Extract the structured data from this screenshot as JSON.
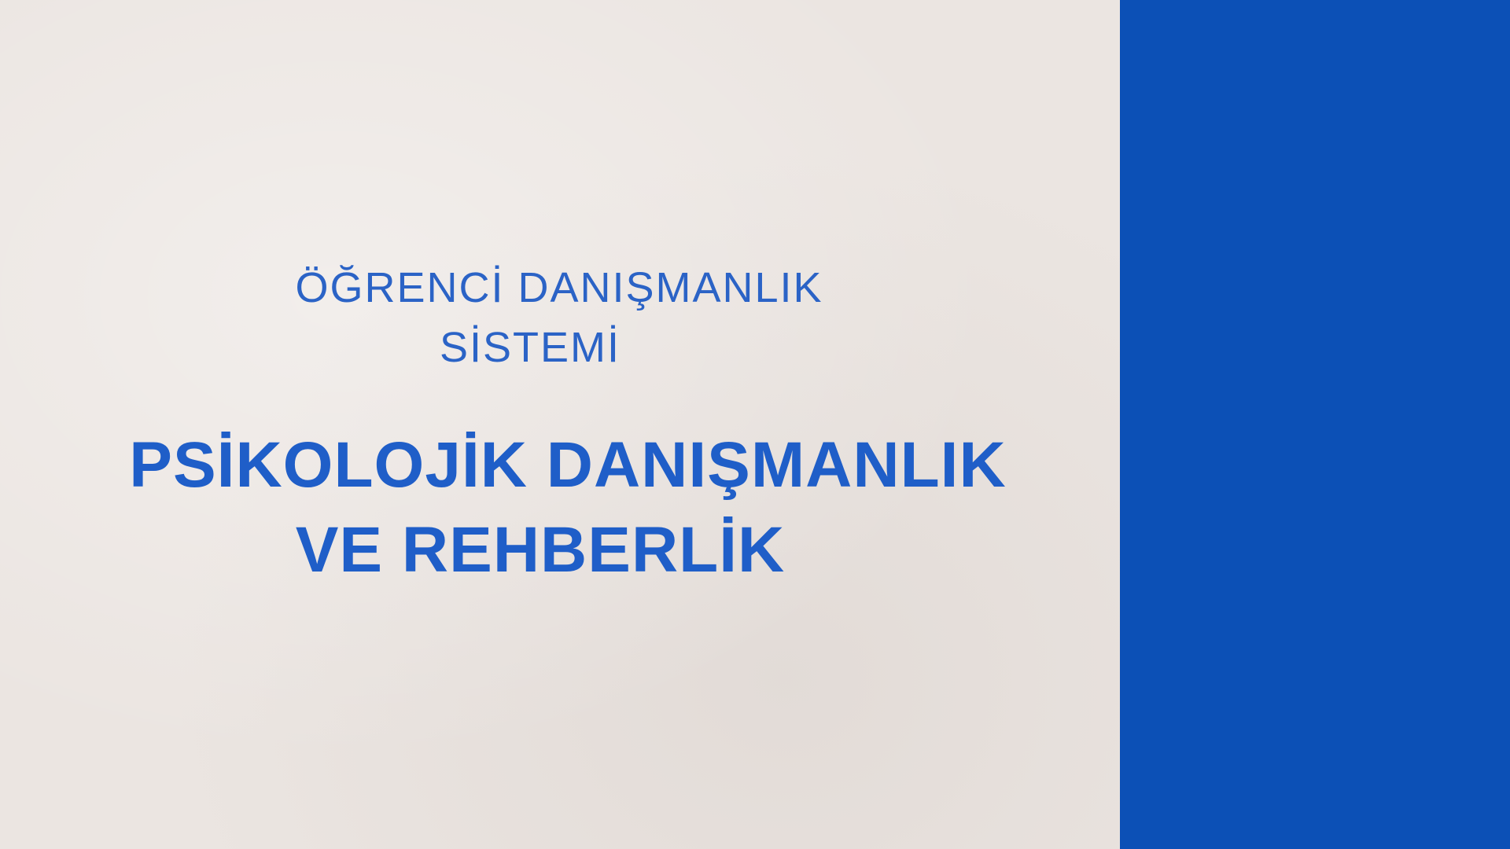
{
  "slide": {
    "subtitle_line1": "ÖĞRENCİ DANIŞMANLIK",
    "subtitle_line2": "SİSTEMİ",
    "title_line1": "PSİKOLOJİK DANIŞMANLIK",
    "title_line2": "VE REHBERLİK"
  },
  "colors": {
    "background": "#ebe5e1",
    "accent_panel": "#0c50b6",
    "text": "#1f5ec8"
  }
}
